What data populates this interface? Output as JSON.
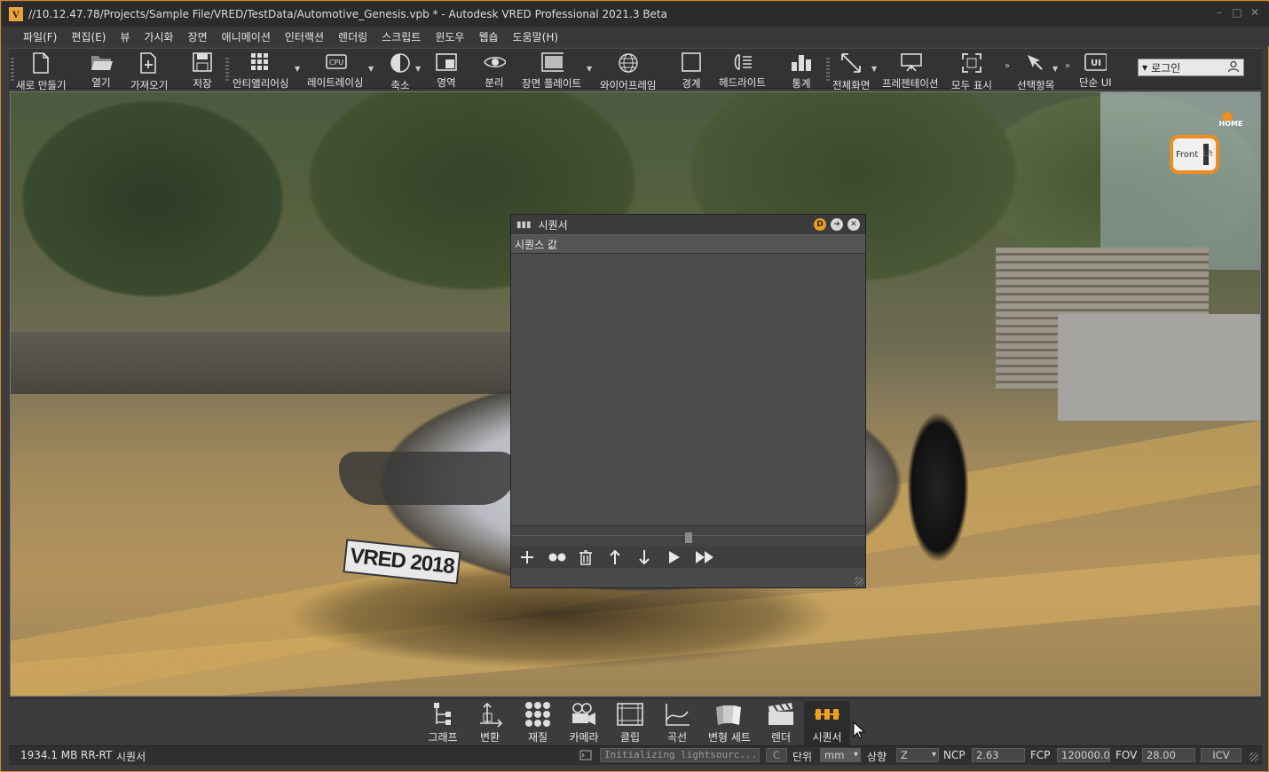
{
  "window": {
    "title": "//10.12.47.78/Projects/Sample File/VRED/TestData/Automotive_Genesis.vpb * - Autodesk VRED Professional 2021.3 Beta",
    "logo_letter": "V"
  },
  "menu": [
    "파일(F)",
    "편집(E)",
    "뷰",
    "가시화",
    "장면",
    "애니메이션",
    "인터랙션",
    "렌더링",
    "스크립트",
    "윈도우",
    "웹숍",
    "도움말(H)"
  ],
  "toolbar": {
    "new": "새로 만들기",
    "open": "열기",
    "import": "가져오기",
    "save": "저장",
    "antialiasing": "안티앨리어싱",
    "raytracing": "레이트레이싱",
    "cpu_badge": "CPU",
    "scale": "축소",
    "region": "영역",
    "separate": "분리",
    "scene_plate": "장면 플레이트",
    "wireframe": "와이어프레임",
    "bounding": "경계",
    "headlight": "헤드라이트",
    "stats": "통계",
    "fullscreen": "전체화면",
    "presentation": "프레젠테이션",
    "show_all": "모두 표시",
    "selection": "선택항목",
    "simple_ui": "단순 UI",
    "ui_badge": "UI",
    "login": "로그인"
  },
  "viewport": {
    "plate_text": "VRED 2018",
    "viewcube": {
      "home": "HOME",
      "front": "Front",
      "side": "Lft"
    }
  },
  "sequencer": {
    "title": "시퀀서",
    "column_header": "시퀀스 값",
    "btn_dock": "D",
    "btn_next": "➔",
    "btn_close": "✕"
  },
  "modules": [
    {
      "label": "그래프"
    },
    {
      "label": "변환"
    },
    {
      "label": "재질"
    },
    {
      "label": "카메라"
    },
    {
      "label": "클립"
    },
    {
      "label": "곡선"
    },
    {
      "label": "변형 세트"
    },
    {
      "label": "렌더"
    },
    {
      "label": "시퀀서"
    }
  ],
  "status": {
    "memory": "1934.1 MB",
    "mode": "RR-RT",
    "module": "시퀀서",
    "message": "Initializing lightsourc...",
    "c_button": "C",
    "unit_label": "단위",
    "unit_value": "mm",
    "up_label": "상향",
    "up_value": "Z",
    "ncp_label": "NCP",
    "ncp_value": "2.63",
    "fcp_label": "FCP",
    "fcp_value": "120000.00",
    "fov_label": "FOV",
    "fov_value": "28.00",
    "icv_label": "ICV"
  },
  "colors": {
    "accent": "#f08c1e",
    "frame_border": "#d4862a",
    "dock_btn": "#e8a020",
    "active_module_icon": "#f0a020"
  }
}
